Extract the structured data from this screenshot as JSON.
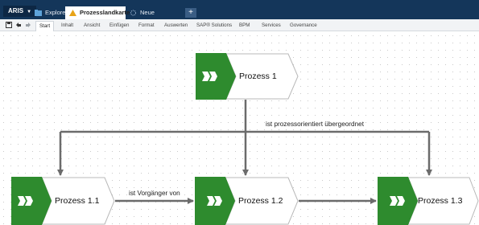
{
  "app": {
    "menu_label": "ARIS",
    "tabs": [
      {
        "label": "Explorer",
        "icon": "explorer-icon"
      },
      {
        "label": "Prozesslandkarte",
        "icon": "process-map-icon",
        "active": true
      },
      {
        "label": "Neue Registerkarte",
        "icon": "new-tab-icon"
      }
    ],
    "close_glyph": "×",
    "add_tab_glyph": "+"
  },
  "ribbon": {
    "tabs": [
      "Start",
      "Inhalt",
      "Ansicht",
      "Einfügen",
      "Format",
      "Auswerten",
      "SAP® Solutions",
      "BPM",
      "Services",
      "Governance"
    ],
    "active_tab": "Start"
  },
  "diagram": {
    "processes": [
      {
        "id": "p1",
        "label": "Prozess 1"
      },
      {
        "id": "p11",
        "label": "Prozess 1.1"
      },
      {
        "id": "p12",
        "label": "Prozess 1.2"
      },
      {
        "id": "p13",
        "label": "Prozess 1.3"
      }
    ],
    "edge_labels": {
      "hierarchy": "ist prozessorientiert übergeordnet",
      "predecessor": "ist Vorgänger von"
    }
  },
  "colors": {
    "title_bar": "#14365a",
    "process_green": "#2e8b2e",
    "connector": "#6b6b6b",
    "process_border": "#b8b8b8"
  }
}
